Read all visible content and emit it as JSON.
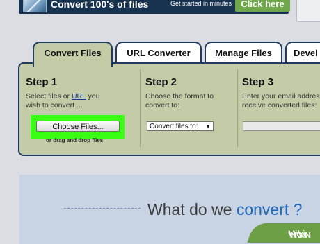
{
  "banner": {
    "headline": "Convert 100's of files",
    "subtext": "Get started in minutes",
    "cta_label": "Click here"
  },
  "tabs": [
    {
      "label": "Convert Files",
      "active": true
    },
    {
      "label": "URL Converter",
      "active": false
    },
    {
      "label": "Manage Files",
      "active": false
    },
    {
      "label": "Devel",
      "active": false
    }
  ],
  "steps": [
    {
      "title": "Step 1",
      "line1_prefix": "Select files or ",
      "line1_link": "URL",
      "line1_suffix": " you",
      "line2": "wish to convert ..."
    },
    {
      "title": "Step 2",
      "line1": "Choose the format to",
      "line2": "convert to:"
    },
    {
      "title": "Step 3",
      "line1": "Enter your email addres",
      "line2": "receive converted files:"
    }
  ],
  "choose_button_label": "Choose Files...",
  "drag_drop_text": "or drag and drop files",
  "format_select_value": "Convert files to:",
  "email_value": "",
  "highlight_color": "#39ff14",
  "question": {
    "prefix": "What do we ",
    "accent": "convert ?"
  },
  "watermark": {
    "wiki": "wiki",
    "how": "How"
  }
}
